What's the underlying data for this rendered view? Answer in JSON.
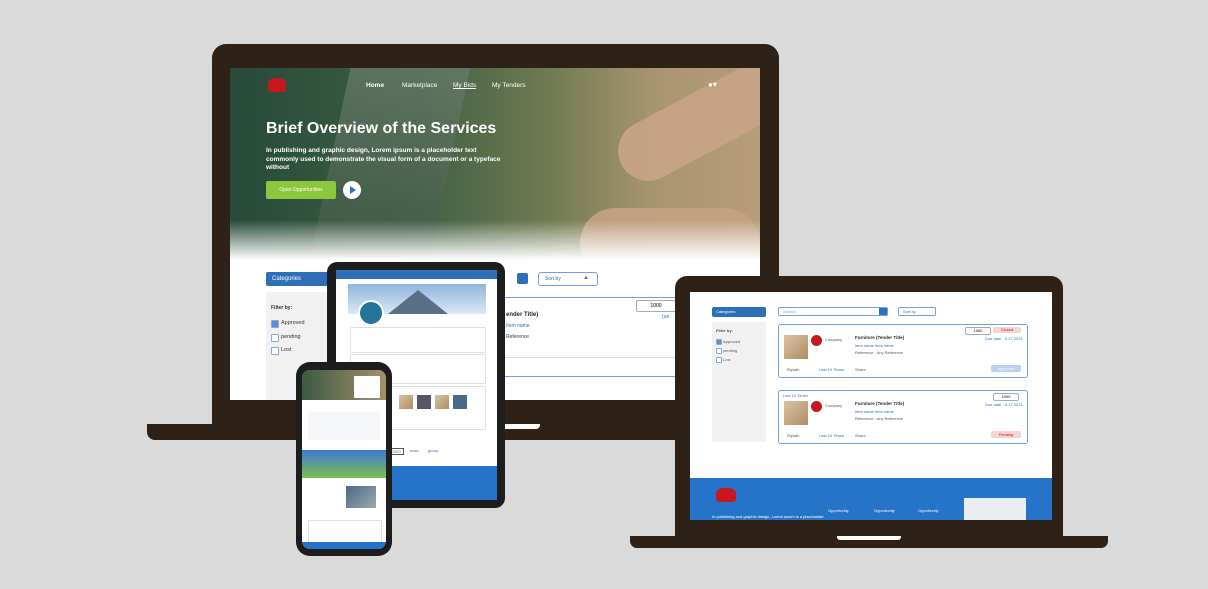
{
  "colors": {
    "background": "#dadada",
    "frame": "#2e2218",
    "brand_blue": "#2f6fb7",
    "cta_green": "#8dc63f",
    "brand_red": "#c8171e",
    "footer_blue": "#2674c9"
  },
  "desktop": {
    "nav": {
      "home": "Home",
      "marketplace": "Marketplace",
      "my_bids": "My Bids",
      "my_tenders": "My Tenders"
    },
    "hero": {
      "title": "Brief Overview of the Services",
      "text": "In publishing and graphic design, Lorem ipsum is a placeholder text commonly used to demonstrate the visual form of a document or a typeface without",
      "cta": "Open Opportunities"
    },
    "categories": "Categories",
    "sort_by": "Sort by",
    "filter_by": "Filter by:",
    "filters": [
      {
        "label": "Approved",
        "checked": true
      },
      {
        "label": "pending",
        "checked": false
      },
      {
        "label": "Lost",
        "checked": false
      }
    ],
    "value": "1000",
    "tender_title": "ender Title)",
    "item_name": "Item name",
    "reference": "Reference",
    "date": "(ue"
  },
  "right_laptop": {
    "categories": "Categories",
    "search_placeholder": "Search",
    "sort_by": "Sort by",
    "filter_by": "Filter by:",
    "filters": [
      {
        "label": "Approved",
        "checked": true
      },
      {
        "label": "pending",
        "checked": false
      },
      {
        "label": "Lost",
        "checked": false
      }
    ],
    "cards": [
      {
        "top": "",
        "company": "Company",
        "title": "Furniture (Tender Title)",
        "items": "Item name   Item name",
        "ref": "Reference : Any Reference",
        "value": "1000",
        "status": "Closed",
        "date": "Due date : 5-17-2021",
        "location": "Riyadh",
        "bids": "Last 10 Times",
        "share": "Share",
        "action": "Approved"
      },
      {
        "top": "Last 10 Times",
        "company": "Company",
        "title": "Furniture (Tender Title)",
        "items": "Item name   Item name",
        "ref": "Reference : Any Reference",
        "value": "1000",
        "status": "",
        "date": "Due date : 5-17-2021",
        "location": "Riyadh",
        "bids": "Last 10 Times",
        "share": "Share",
        "action": "Pending"
      }
    ],
    "footer_text": "In publishing and graphic design, Lorem ipsum is a placeholder",
    "footer_cols": [
      "Opportunity",
      "Opportunity",
      "Opportunity"
    ]
  },
  "tablet": {
    "brand_logos": [
      "go.gai",
      "LOGO",
      "novo",
      "group"
    ]
  },
  "phone": {}
}
